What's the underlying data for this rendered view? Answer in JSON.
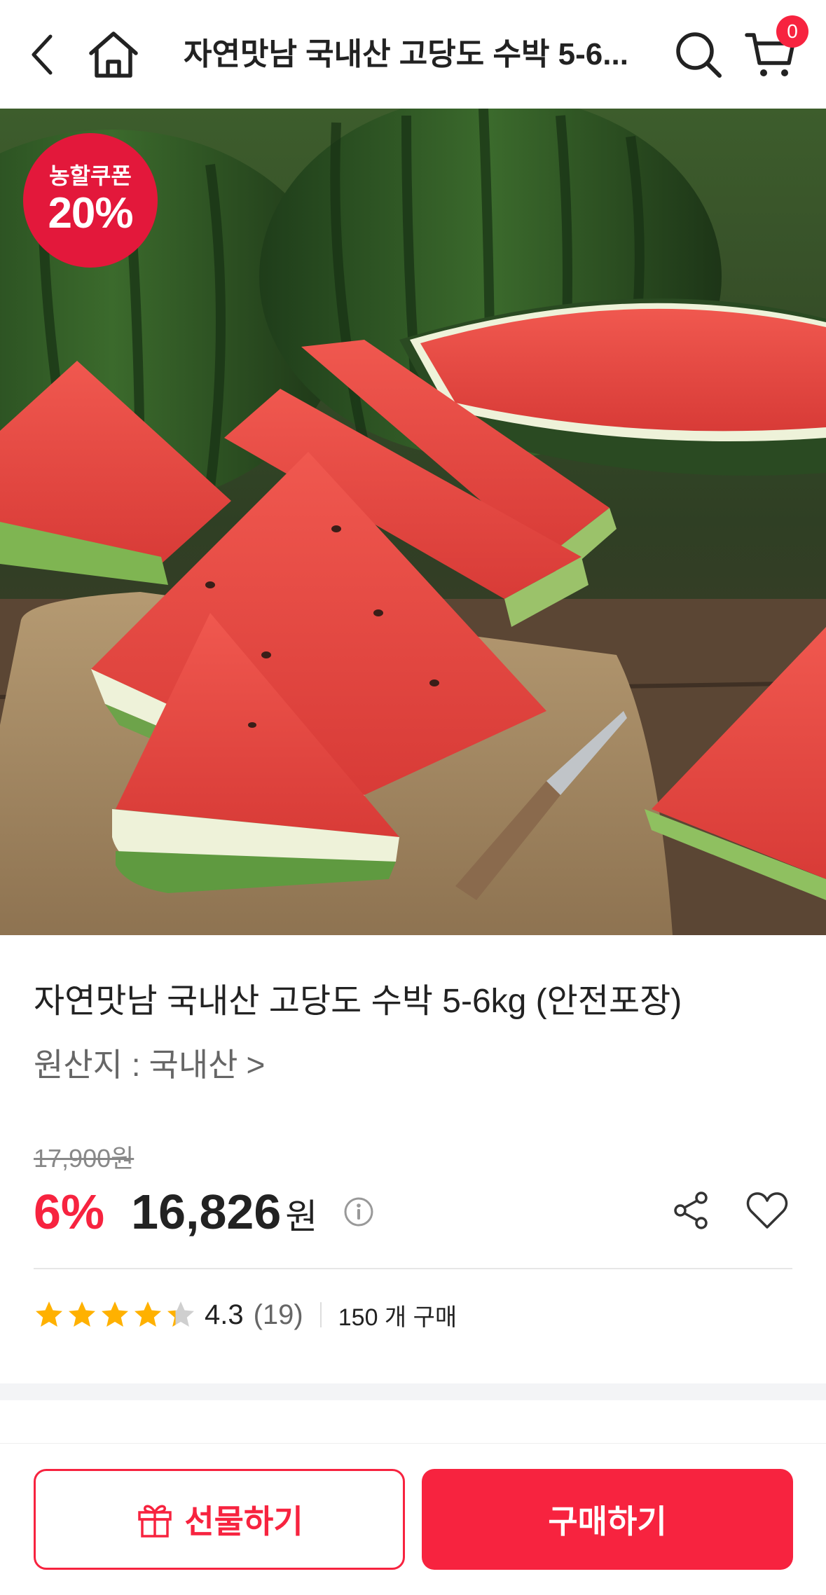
{
  "header": {
    "title": "자연맛남 국내산 고당도 수박 5-6...",
    "cart_count": "0"
  },
  "hero": {
    "coupon_label": "농할쿠폰",
    "coupon_value": "20%"
  },
  "product": {
    "title": "자연맛남 국내산 고당도 수박 5-6kg (안전포장)",
    "origin_label": "원산지 :",
    "origin_value": "국내산",
    "origin_chevron": ">",
    "original_price": "17,900원",
    "discount": "6%",
    "price": "16,826",
    "currency": "원",
    "rating": "4.3",
    "rating_score": 4.3,
    "review_count": "(19)",
    "purchases": "150 개 구매"
  },
  "actions": {
    "gift_label": "선물하기",
    "buy_label": "구매하기"
  },
  "colors": {
    "accent": "#f7233f",
    "coupon": "#e3183b",
    "star": "#ffb100"
  }
}
